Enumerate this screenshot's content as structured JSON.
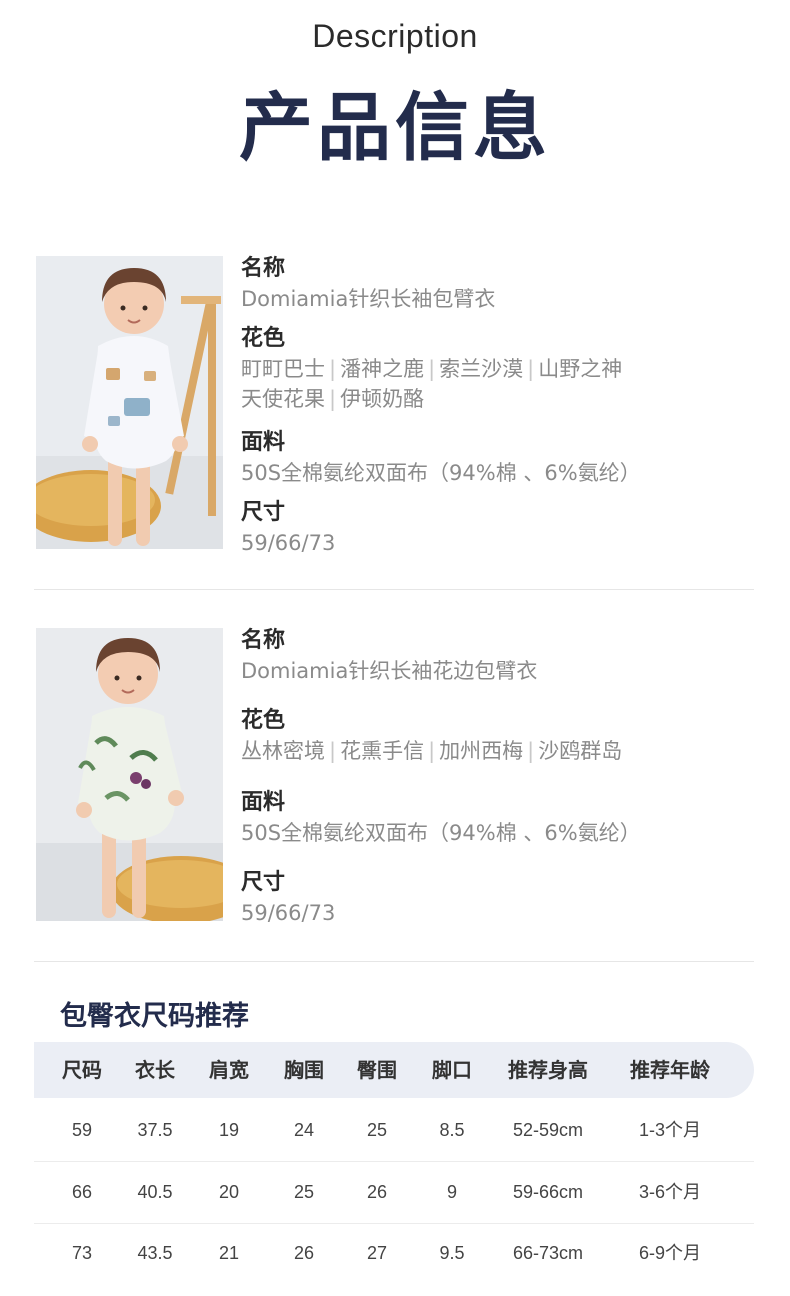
{
  "header": {
    "title_en": "Description",
    "title_cn": "产品信息"
  },
  "products": [
    {
      "name_label": "名称",
      "name": "Domiamia针织长袖包臂衣",
      "color_label": "花色",
      "colors_line1": [
        "町町巴士",
        "潘神之鹿",
        "索兰沙漠",
        "山野之神"
      ],
      "colors_line2": [
        "天使花果",
        "伊顿奶酪"
      ],
      "fabric_label": "面料",
      "fabric": "50S全棉氨纶双面布（94%棉 、6%氨纶）",
      "size_label": "尺寸",
      "sizes": "59/66/73"
    },
    {
      "name_label": "名称",
      "name": "Domiamia针织长袖花边包臂衣",
      "color_label": "花色",
      "colors_line1": [
        "丛林密境",
        "花熏手信",
        "加州西梅",
        "沙鸥群岛"
      ],
      "fabric_label": "面料",
      "fabric": "50S全棉氨纶双面布（94%棉 、6%氨纶）",
      "size_label": "尺寸",
      "sizes": "59/66/73"
    }
  ],
  "size_chart": {
    "title": "包臀衣尺码推荐",
    "headers": [
      "尺码",
      "衣长",
      "肩宽",
      "胸围",
      "臀围",
      "脚口",
      "推荐身高",
      "推荐年龄"
    ],
    "rows": [
      [
        "59",
        "37.5",
        "19",
        "24",
        "25",
        "8.5",
        "52-59cm",
        "1-3个月"
      ],
      [
        "66",
        "40.5",
        "20",
        "25",
        "26",
        "9",
        "59-66cm",
        "3-6个月"
      ],
      [
        "73",
        "43.5",
        "21",
        "26",
        "27",
        "9.5",
        "66-73cm",
        "6-9个月"
      ]
    ]
  },
  "colors": {
    "heading_navy": "#232c4c",
    "value_gray": "#8a8a8a",
    "table_header_bg": "#ebeef5"
  }
}
